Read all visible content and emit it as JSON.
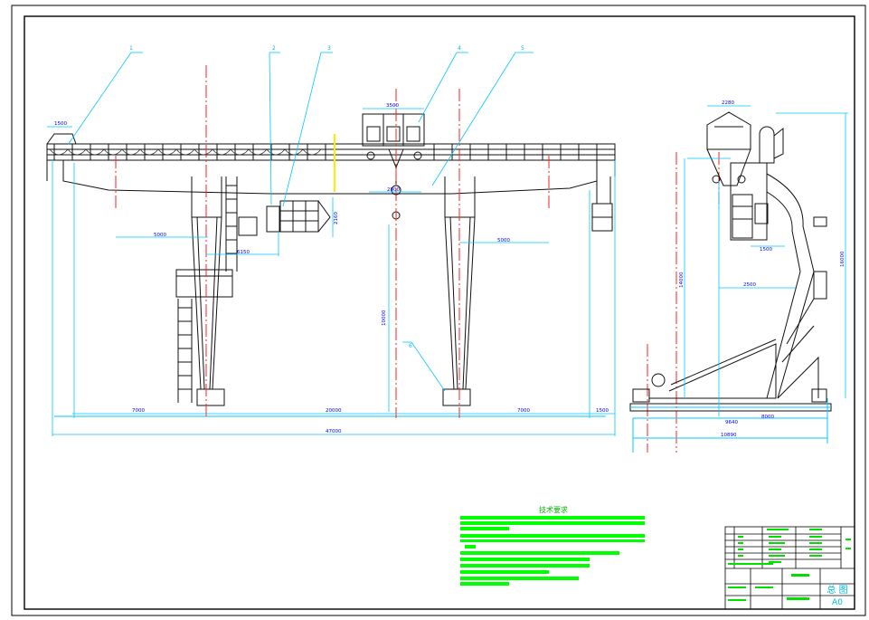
{
  "callouts": [
    "1",
    "2",
    "3",
    "4",
    "5",
    "6"
  ],
  "dims": {
    "d1500a": "1500",
    "d3500": "3500",
    "d2800": "2800",
    "d5000a": "5000",
    "d6150": "6150",
    "d2160": "2160",
    "d10000": "10000",
    "d5000b": "5000",
    "d7000a": "7000",
    "d20000": "20000",
    "d7000b": "7000",
    "d1500b": "1500",
    "d47000": "47000",
    "d2280": "2280",
    "d1500c": "1500",
    "d2500": "2500",
    "d14000": "14000",
    "d16000": "16000",
    "d9640": "9640",
    "d8000": "8000",
    "d10890": "10890"
  },
  "notes_title": "技术要求",
  "title_block": {
    "drawing_name": "总  图",
    "sheet_size": "A0"
  },
  "colors": {
    "outline": "#000000",
    "dimension": "#00c8ff",
    "centerline": "#ff0000",
    "notes": "#00ff00",
    "highlight": "#ffff00",
    "structure": "#1a1a1a"
  }
}
